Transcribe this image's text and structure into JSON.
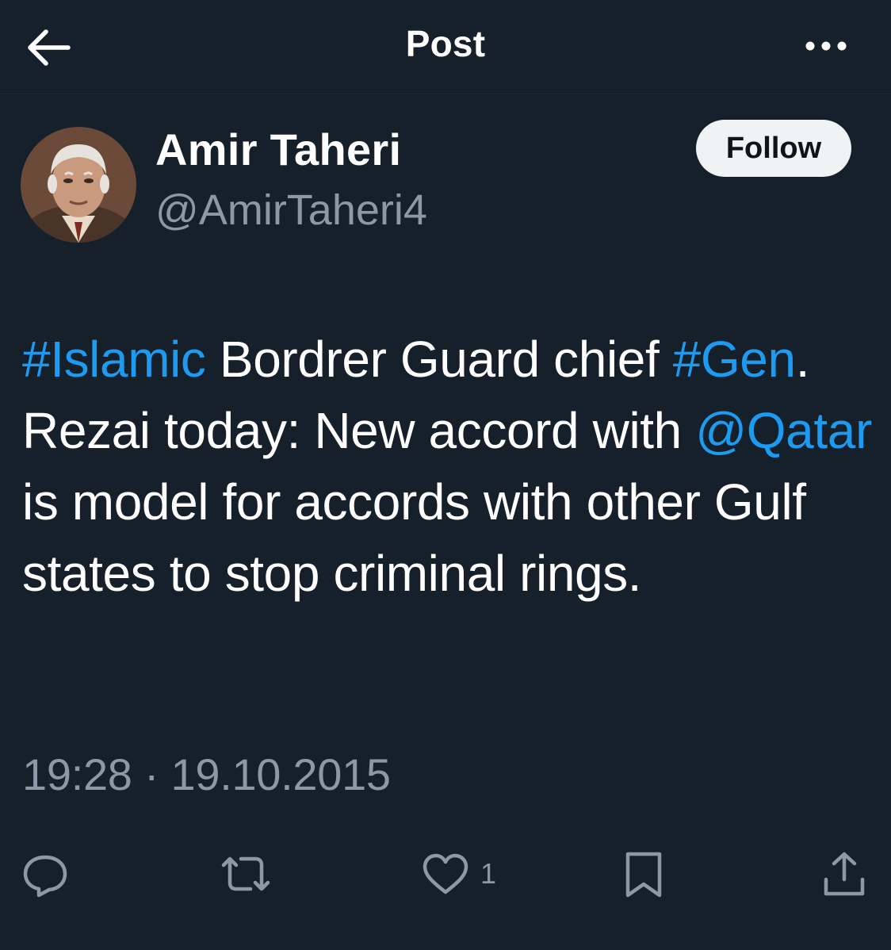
{
  "header": {
    "title": "Post",
    "back_icon": "arrow-left-icon",
    "more_icon": "more-horizontal-icon"
  },
  "author": {
    "display_name": "Amir Taheri",
    "handle": "@AmirTaheri4",
    "avatar": "avatar-photo",
    "follow_label": "Follow"
  },
  "tweet": {
    "segments": [
      {
        "text": "#Islamic",
        "link": true
      },
      {
        "text": " Bordrer Guard chief ",
        "link": false
      },
      {
        "text": "#Gen",
        "link": true
      },
      {
        "text": ". Rezai today: New accord with ",
        "link": false
      },
      {
        "text": "@Qatar",
        "link": true
      },
      {
        "text": " is model for accords with other Gulf states to stop criminal rings.",
        "link": false
      }
    ],
    "timestamp": "19:28 · 19.10.2015"
  },
  "actions": {
    "reply_icon": "reply-icon",
    "retweet_icon": "retweet-icon",
    "like_icon": "heart-icon",
    "like_count": "1",
    "bookmark_icon": "bookmark-icon",
    "share_icon": "share-icon"
  },
  "colors": {
    "background": "#15202b",
    "link": "#1d9bf0",
    "secondary_text": "#8b98a5",
    "follow_button": "#eff3f4"
  }
}
